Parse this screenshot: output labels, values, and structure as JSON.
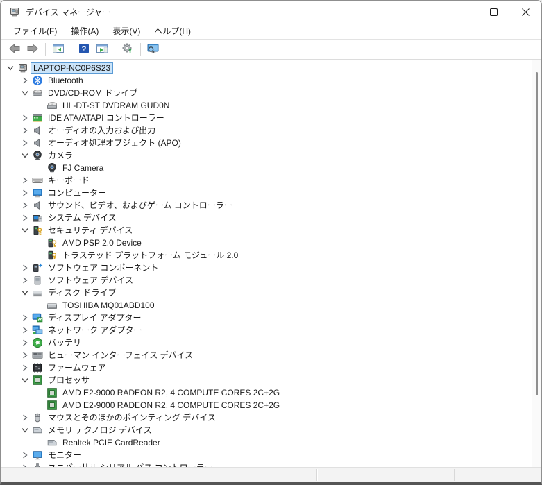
{
  "window": {
    "title": "デバイス マネージャー",
    "app_icon": "device-manager-icon",
    "controls": [
      {
        "name": "minimize-button",
        "icon": "minimize-icon"
      },
      {
        "name": "maximize-button",
        "icon": "maximize-icon"
      },
      {
        "name": "close-button",
        "icon": "close-icon"
      }
    ]
  },
  "menu": {
    "items": [
      {
        "name": "menu-file",
        "label": "ファイル(F)"
      },
      {
        "name": "menu-action",
        "label": "操作(A)"
      },
      {
        "name": "menu-view",
        "label": "表示(V)"
      },
      {
        "name": "menu-help",
        "label": "ヘルプ(H)"
      }
    ]
  },
  "toolbar": {
    "buttons": [
      {
        "name": "back-button",
        "icon": "back-arrow-icon"
      },
      {
        "name": "forward-button",
        "icon": "forward-arrow-icon"
      },
      {
        "sep": true
      },
      {
        "name": "show-console-tree-button",
        "icon": "console-tree-icon"
      },
      {
        "sep": true
      },
      {
        "name": "help-button",
        "icon": "help-icon"
      },
      {
        "name": "properties-button",
        "icon": "properties-icon"
      },
      {
        "sep": true
      },
      {
        "name": "scan-hardware-changes-button",
        "icon": "scan-gear-icon"
      },
      {
        "sep": true
      },
      {
        "name": "computer-search-button",
        "icon": "monitor-search-icon"
      }
    ]
  },
  "tree": {
    "items": [
      {
        "label": "LAPTOP-NC0P6S23",
        "level": 0,
        "state": "expanded",
        "icon": "computer-icon",
        "selected": true
      },
      {
        "label": "Bluetooth",
        "level": 1,
        "state": "collapsed",
        "icon": "bluetooth-icon"
      },
      {
        "label": "DVD/CD-ROM ドライブ",
        "level": 1,
        "state": "expanded",
        "icon": "cd-drive-icon"
      },
      {
        "label": "HL-DT-ST DVDRAM GUD0N",
        "level": 2,
        "state": "leaf",
        "icon": "cd-drive-icon"
      },
      {
        "label": "IDE ATA/ATAPI コントローラー",
        "level": 1,
        "state": "collapsed",
        "icon": "ide-controller-icon"
      },
      {
        "label": "オーディオの入力および出力",
        "level": 1,
        "state": "collapsed",
        "icon": "speaker-icon"
      },
      {
        "label": "オーディオ処理オブジェクト (APO)",
        "level": 1,
        "state": "collapsed",
        "icon": "speaker-icon"
      },
      {
        "label": "カメラ",
        "level": 1,
        "state": "expanded",
        "icon": "camera-icon"
      },
      {
        "label": "FJ Camera",
        "level": 2,
        "state": "leaf",
        "icon": "camera-icon"
      },
      {
        "label": "キーボード",
        "level": 1,
        "state": "collapsed",
        "icon": "keyboard-icon"
      },
      {
        "label": "コンピューター",
        "level": 1,
        "state": "collapsed",
        "icon": "monitor-icon"
      },
      {
        "label": "サウンド、ビデオ、およびゲーム コントローラー",
        "level": 1,
        "state": "collapsed",
        "icon": "speaker-icon"
      },
      {
        "label": "システム デバイス",
        "level": 1,
        "state": "collapsed",
        "icon": "system-device-icon"
      },
      {
        "label": "セキュリティ デバイス",
        "level": 1,
        "state": "expanded",
        "icon": "security-icon"
      },
      {
        "label": "AMD PSP 2.0 Device",
        "level": 2,
        "state": "leaf",
        "icon": "security-icon"
      },
      {
        "label": "トラステッド プラットフォーム モジュール 2.0",
        "level": 2,
        "state": "leaf",
        "icon": "security-icon"
      },
      {
        "label": "ソフトウェア コンポーネント",
        "level": 1,
        "state": "collapsed",
        "icon": "software-component-icon"
      },
      {
        "label": "ソフトウェア デバイス",
        "level": 1,
        "state": "collapsed",
        "icon": "software-device-icon"
      },
      {
        "label": "ディスク ドライブ",
        "level": 1,
        "state": "expanded",
        "icon": "disk-drive-icon"
      },
      {
        "label": "TOSHIBA MQ01ABD100",
        "level": 2,
        "state": "leaf",
        "icon": "disk-drive-icon"
      },
      {
        "label": "ディスプレイ アダプター",
        "level": 1,
        "state": "collapsed",
        "icon": "display-adapter-icon"
      },
      {
        "label": "ネットワーク アダプター",
        "level": 1,
        "state": "collapsed",
        "icon": "network-adapter-icon"
      },
      {
        "label": "バッテリ",
        "level": 1,
        "state": "collapsed",
        "icon": "battery-icon"
      },
      {
        "label": "ヒューマン インターフェイス デバイス",
        "level": 1,
        "state": "collapsed",
        "icon": "hid-icon"
      },
      {
        "label": "ファームウェア",
        "level": 1,
        "state": "collapsed",
        "icon": "firmware-icon"
      },
      {
        "label": "プロセッサ",
        "level": 1,
        "state": "expanded",
        "icon": "processor-icon"
      },
      {
        "label": "AMD E2-9000 RADEON R2, 4 COMPUTE CORES 2C+2G",
        "level": 2,
        "state": "leaf",
        "icon": "processor-icon"
      },
      {
        "label": "AMD E2-9000 RADEON R2, 4 COMPUTE CORES 2C+2G",
        "level": 2,
        "state": "leaf",
        "icon": "processor-icon"
      },
      {
        "label": "マウスとそのほかのポインティング デバイス",
        "level": 1,
        "state": "collapsed",
        "icon": "mouse-icon"
      },
      {
        "label": "メモリ テクノロジ デバイス",
        "level": 1,
        "state": "expanded",
        "icon": "memory-card-icon"
      },
      {
        "label": "Realtek PCIE CardReader",
        "level": 2,
        "state": "leaf",
        "icon": "memory-card-icon"
      },
      {
        "label": "モニター",
        "level": 1,
        "state": "collapsed",
        "icon": "monitor-icon"
      },
      {
        "label": "ユニバーサル シリアル バス コントローラー",
        "level": 1,
        "state": "collapsed",
        "icon": "usb-icon"
      }
    ]
  },
  "colors": {
    "selection_bg": "#cbe4f9",
    "selection_border": "#5b9bd5",
    "accent_blue": "#2b88d8",
    "device_green": "#3fae49",
    "key_gold": "#d9a421"
  }
}
